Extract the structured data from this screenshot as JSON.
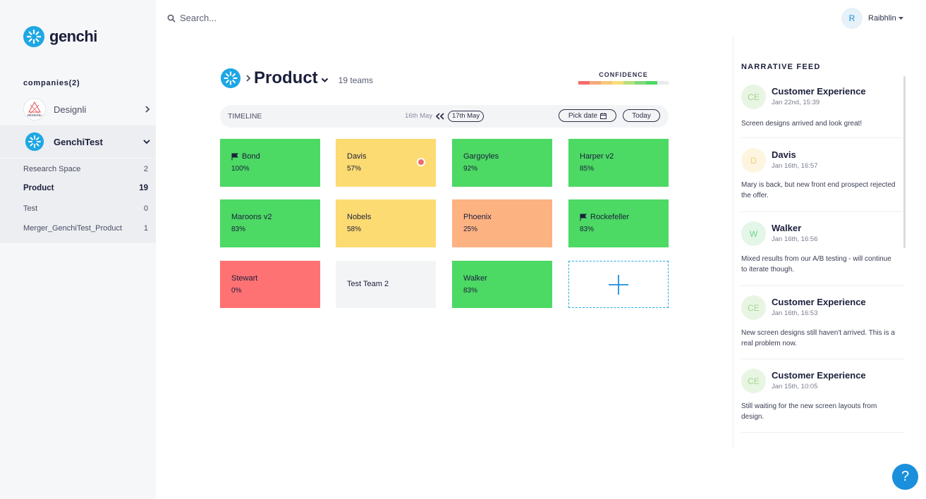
{
  "brand": {
    "name": "genchi"
  },
  "sidebar": {
    "companies_heading": "companies(2)",
    "companies": [
      {
        "name": "Designli",
        "logo_text": "DESIGNLI",
        "expanded": false
      },
      {
        "name": "GenchiTest",
        "expanded": true
      }
    ],
    "spaces": [
      {
        "label": "Research Space",
        "count": "2"
      },
      {
        "label": "Product",
        "count": "19",
        "active": true
      },
      {
        "label": "Test",
        "count": "0"
      },
      {
        "label": "Merger_GenchiTest_Product",
        "count": "1"
      }
    ]
  },
  "topbar": {
    "search_placeholder": "Search...",
    "user_initial": "R",
    "user_name": "Raibhlin"
  },
  "main": {
    "title": "Product",
    "teams_count": "19 teams",
    "confidence_label": "CONFIDENCE",
    "confidence_colors": [
      "#f26d6d",
      "#f5a97a",
      "#f7c77a",
      "#f7df7a",
      "#b6e07a",
      "#7dd87a",
      "#4cd964",
      "#e9eaee"
    ],
    "timeline": {
      "label": "TIMELINE",
      "previous_date": "16th May",
      "current_date": "17th May",
      "pick_date_label": "Pick date",
      "today_label": "Today"
    },
    "teams": [
      {
        "name": "Bond",
        "percent": "100%",
        "color": "#4cd964",
        "flag": true
      },
      {
        "name": "Davis",
        "percent": "57%",
        "color": "#fcdb72",
        "alert": true
      },
      {
        "name": "Gargoyles",
        "percent": "92%",
        "color": "#4cd964"
      },
      {
        "name": "Harper v2",
        "percent": "85%",
        "color": "#4cd964"
      },
      {
        "name": "Maroons v2",
        "percent": "83%",
        "color": "#4cd964"
      },
      {
        "name": "Nobels",
        "percent": "58%",
        "color": "#fcdb72"
      },
      {
        "name": "Phoenix",
        "percent": "25%",
        "color": "#fdb282"
      },
      {
        "name": "Rockefeller",
        "percent": "83%",
        "color": "#4cd964",
        "flag": true
      },
      {
        "name": "Stewart",
        "percent": "0%",
        "color": "#fe7273"
      },
      {
        "name": "Test Team 2",
        "percent": "",
        "color": "#f3f4f6"
      },
      {
        "name": "Walker",
        "percent": "83%",
        "color": "#4cd964"
      }
    ]
  },
  "feed": {
    "title": "NARRATIVE FEED",
    "posts": [
      {
        "initials": "CE",
        "name": "Customer Experience",
        "time": "Jan 22nd, 15:39",
        "text": "Screen designs arrived and look great!",
        "avatar_bg": "#e8f5e3",
        "avatar_fg": "#a6d78a"
      },
      {
        "initials": "D",
        "name": "Davis",
        "time": "Jan 16th, 16:57",
        "text": "Mary is back, but new front end prospect rejected the offer.",
        "avatar_bg": "#fdf5e0",
        "avatar_fg": "#f2cf6f"
      },
      {
        "initials": "W",
        "name": "Walker",
        "time": "Jan 16th, 16:56",
        "text": "Mixed results from our A/B testing - will continue to iterate though.",
        "avatar_bg": "#e3f6e8",
        "avatar_fg": "#6fd78a"
      },
      {
        "initials": "CE",
        "name": "Customer Experience",
        "time": "Jan 16th, 16:53",
        "text": "New screen designs still haven't arrived. This is a real problem now.",
        "avatar_bg": "#e8f5e3",
        "avatar_fg": "#a6d78a"
      },
      {
        "initials": "CE",
        "name": "Customer Experience",
        "time": "Jan 15th, 10:05",
        "text": "Still waiting for the new screen layouts from design.",
        "avatar_bg": "#e8f5e3",
        "avatar_fg": "#a6d78a"
      }
    ]
  },
  "help": {
    "label": "?"
  }
}
